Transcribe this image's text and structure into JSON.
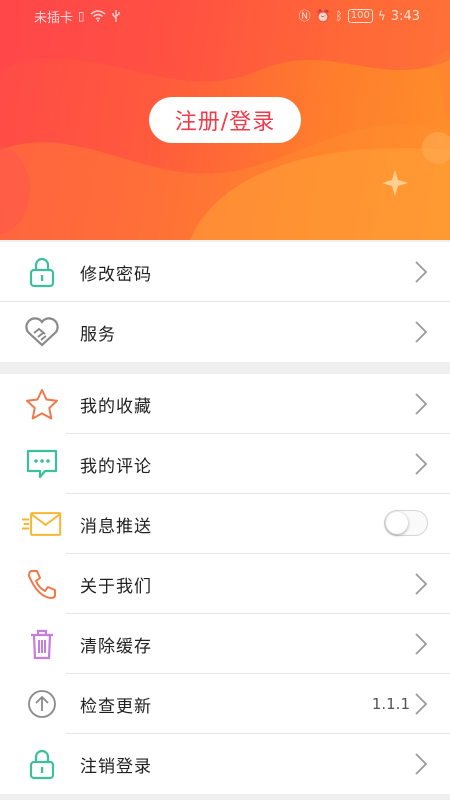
{
  "status_bar": {
    "carrier": "未插卡",
    "time": "3:43",
    "battery": "100",
    "icons": [
      "sim-icon",
      "wifi-icon",
      "usb-icon",
      "nfc-icon",
      "alarm-icon",
      "bluetooth-icon",
      "battery-icon",
      "charging-icon"
    ]
  },
  "header": {
    "login_label": "注册/登录",
    "gradient_start": "#ff4a48",
    "gradient_end": "#ff8f2a"
  },
  "menu_group_1": [
    {
      "label": "修改密码",
      "icon": "lock-icon",
      "color": "#3cbf9f"
    },
    {
      "label": "服务",
      "icon": "handshake-icon",
      "color": "#8a8a8a"
    }
  ],
  "menu_group_2": [
    {
      "label": "我的收藏",
      "icon": "star-icon",
      "color": "#f0784a"
    },
    {
      "label": "我的评论",
      "icon": "comment-icon",
      "color": "#3cbf9f"
    },
    {
      "label": "消息推送",
      "icon": "mail-icon",
      "color": "#f7b733",
      "toggle": false
    },
    {
      "label": "关于我们",
      "icon": "phone-icon",
      "color": "#f0784a"
    },
    {
      "label": "清除缓存",
      "icon": "trash-icon",
      "color": "#c77ddb"
    },
    {
      "label": "检查更新",
      "icon": "upload-icon",
      "color": "#8a8a8a",
      "value": "1.1.1"
    },
    {
      "label": "注销登录",
      "icon": "lock-icon",
      "color": "#3cbf9f"
    }
  ]
}
